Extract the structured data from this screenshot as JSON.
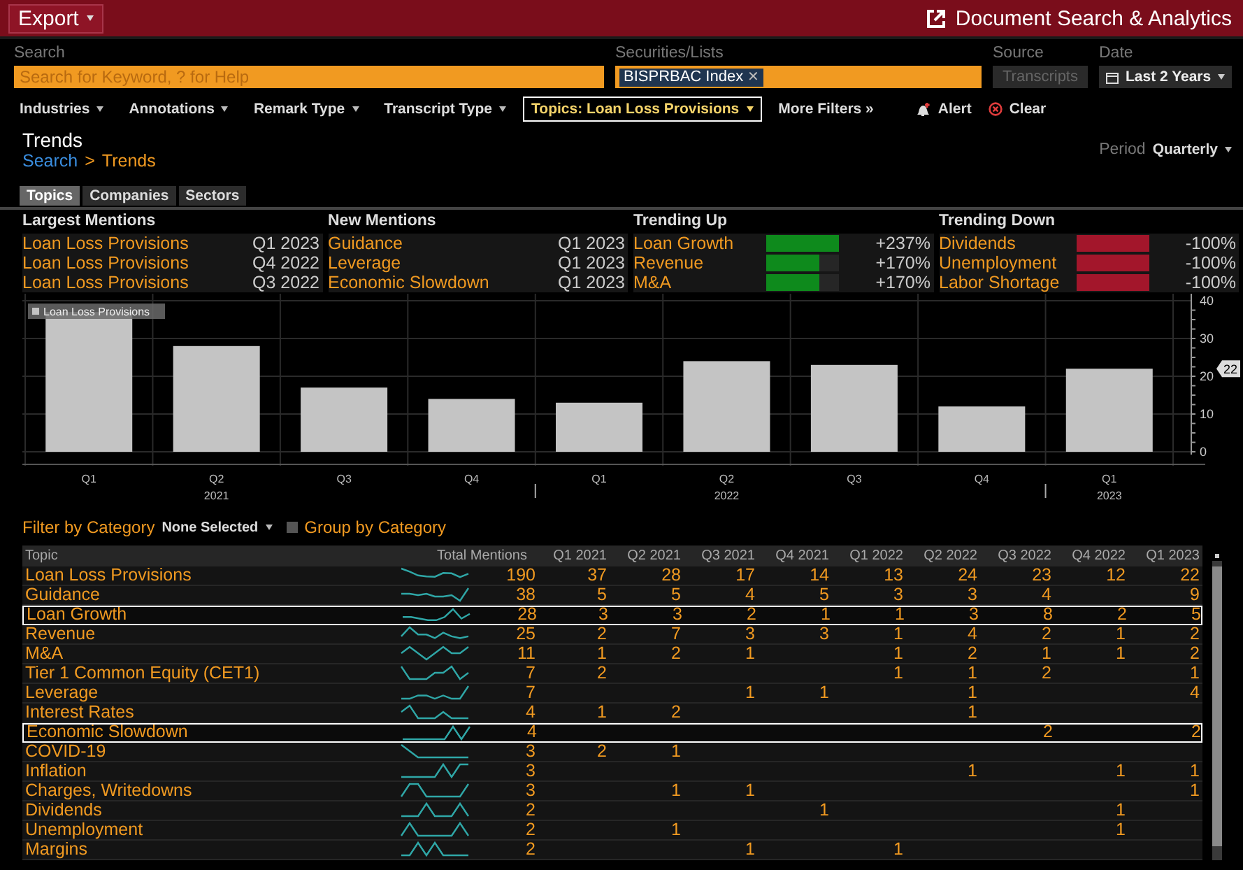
{
  "top_bar": {
    "export_button": "Export",
    "title": "Document Search & Analytics"
  },
  "search_bar": {
    "search": {
      "label": "Search",
      "placeholder": "Search for Keyword, ? for Help"
    },
    "securities": {
      "label": "Securities/Lists",
      "chips": [
        {
          "label": "BISPRBAC Index",
          "remove": "✕"
        }
      ]
    },
    "source": {
      "label": "Source",
      "value": "Transcripts",
      "disabled": true
    },
    "date": {
      "label": "Date",
      "value": "Last 2 Years"
    }
  },
  "filters": [
    {
      "kind": "dropdown",
      "label": "Industries",
      "selected": false
    },
    {
      "kind": "dropdown",
      "label": "Annotations",
      "selected": false
    },
    {
      "kind": "dropdown",
      "label": "Remark Type",
      "selected": false
    },
    {
      "kind": "dropdown",
      "label": "Transcript Type",
      "selected": false
    },
    {
      "kind": "dropdown",
      "label": "Topics: Loan Loss Provisions",
      "selected": true
    },
    {
      "kind": "more",
      "label": "More Filters »",
      "selected": false
    },
    {
      "kind": "alert",
      "label": "Alert",
      "selected": false
    },
    {
      "kind": "clear",
      "label": "Clear",
      "selected": false
    }
  ],
  "page": {
    "title": "Trends",
    "breadcrumb": [
      "Search",
      "Trends"
    ],
    "separator": ">",
    "period_label": "Period",
    "period_value": "Quarterly"
  },
  "tabs": [
    {
      "label": "Topics",
      "selected": true
    },
    {
      "label": "Companies",
      "selected": false
    },
    {
      "label": "Sectors",
      "selected": false
    }
  ],
  "mentions": [
    {
      "kind": "period",
      "title": "Largest Mentions",
      "items": [
        {
          "topic": "Loan Loss Provisions",
          "value": "Q1 2023"
        },
        {
          "topic": "Loan Loss Provisions",
          "value": "Q4 2022"
        },
        {
          "topic": "Loan Loss Provisions",
          "value": "Q3 2022"
        }
      ]
    },
    {
      "kind": "period",
      "title": "New Mentions",
      "items": [
        {
          "topic": "Guidance",
          "value": "Q1 2023"
        },
        {
          "topic": "Leverage",
          "value": "Q1 2023"
        },
        {
          "topic": "Economic Slowdown",
          "value": "Q1 2023"
        }
      ]
    },
    {
      "kind": "trend",
      "title": "Trending Up",
      "color": "#0e8a1c",
      "items": [
        {
          "topic": "Loan Growth",
          "value": "+237%",
          "level": 1
        },
        {
          "topic": "Revenue",
          "value": "+170%",
          "level": 0.72
        },
        {
          "topic": "M&A",
          "value": "+170%",
          "level": 0.72
        }
      ]
    },
    {
      "kind": "trend",
      "title": "Trending Down",
      "color": "#a3162b",
      "items": [
        {
          "topic": "Dividends",
          "value": "-100%",
          "level": 1
        },
        {
          "topic": "Unemployment",
          "value": "-100%",
          "level": 1
        },
        {
          "topic": "Labor Shortage",
          "value": "-100%",
          "level": 1
        }
      ]
    }
  ],
  "chart": {
    "year_labels": [
      "2021",
      "2022",
      "2023"
    ],
    "value_marker": "22",
    "chart_data": {
      "type": "bar",
      "categories": [
        "Q1",
        "Q2",
        "Q3",
        "Q4",
        "Q1",
        "Q2",
        "Q3",
        "Q4",
        "Q1"
      ],
      "series": [
        {
          "name": "Loan Loss Provisions",
          "color": "#c4c4c4",
          "values": [
            37,
            28,
            17,
            14,
            13,
            24,
            23,
            12,
            22
          ]
        }
      ],
      "ylim": [
        0,
        40
      ],
      "yticks": [
        0,
        10,
        20,
        30,
        40
      ],
      "grid": true
    }
  },
  "category_bar": {
    "filter_label": "Filter by Category",
    "filter_value": "None Selected",
    "group_label": "Group by Category",
    "group_checked": false
  },
  "table": {
    "columns": [
      "Topic",
      "Total Mentions",
      "Q1 2021",
      "Q2 2021",
      "Q3 2021",
      "Q4 2021",
      "Q1 2022",
      "Q2 2022",
      "Q3 2022",
      "Q4 2022",
      "Q1 2023"
    ],
    "rows": [
      {
        "topic": "Loan Loss Provisions",
        "total": "190",
        "highlighted": false,
        "counts": {
          "q1_2021": "37",
          "q2_2021": "28",
          "q3_2021": "17",
          "q4_2021": "14",
          "q1_2022": "13",
          "q2_2022": "24",
          "q3_2022": "23",
          "q4_2022": "12",
          "q1_2023": "22"
        }
      },
      {
        "topic": "Guidance",
        "total": "38",
        "highlighted": false,
        "counts": {
          "q1_2021": "5",
          "q2_2021": "5",
          "q3_2021": "4",
          "q4_2021": "5",
          "q1_2022": "3",
          "q2_2022": "3",
          "q3_2022": "4",
          "q1_2023": "9"
        }
      },
      {
        "topic": "Loan Growth",
        "total": "28",
        "highlighted": true,
        "counts": {
          "q1_2021": "3",
          "q2_2021": "3",
          "q3_2021": "2",
          "q4_2021": "1",
          "q1_2022": "1",
          "q2_2022": "3",
          "q3_2022": "8",
          "q4_2022": "2",
          "q1_2023": "5"
        }
      },
      {
        "topic": "Revenue",
        "total": "25",
        "highlighted": false,
        "counts": {
          "q1_2021": "2",
          "q2_2021": "7",
          "q3_2021": "3",
          "q4_2021": "3",
          "q1_2022": "1",
          "q2_2022": "4",
          "q3_2022": "2",
          "q4_2022": "1",
          "q1_2023": "2"
        }
      },
      {
        "topic": "M&A",
        "total": "11",
        "highlighted": false,
        "counts": {
          "q1_2021": "1",
          "q2_2021": "2",
          "q3_2021": "1",
          "q1_2022": "1",
          "q2_2022": "2",
          "q3_2022": "1",
          "q4_2022": "1",
          "q1_2023": "2"
        }
      },
      {
        "topic": "Tier 1 Common Equity (CET1)",
        "total": "7",
        "highlighted": false,
        "counts": {
          "q1_2021": "2",
          "q1_2022": "1",
          "q2_2022": "1",
          "q3_2022": "2",
          "q1_2023": "1"
        }
      },
      {
        "topic": "Leverage",
        "total": "7",
        "highlighted": false,
        "counts": {
          "q3_2021": "1",
          "q4_2021": "1",
          "q2_2022": "1",
          "q1_2023": "4"
        }
      },
      {
        "topic": "Interest Rates",
        "total": "4",
        "highlighted": false,
        "counts": {
          "q1_2021": "1",
          "q2_2021": "2",
          "q2_2022": "1"
        }
      },
      {
        "topic": "Economic Slowdown",
        "total": "4",
        "highlighted": true,
        "counts": {
          "q3_2022": "2",
          "q1_2023": "2"
        }
      },
      {
        "topic": "COVID-19",
        "total": "3",
        "highlighted": false,
        "counts": {
          "q1_2021": "2",
          "q2_2021": "1"
        }
      },
      {
        "topic": "Inflation",
        "total": "3",
        "highlighted": false,
        "counts": {
          "q2_2022": "1",
          "q4_2022": "1",
          "q1_2023": "1"
        }
      },
      {
        "topic": "Charges, Writedowns",
        "total": "3",
        "highlighted": false,
        "counts": {
          "q2_2021": "1",
          "q3_2021": "1",
          "q1_2023": "1"
        }
      },
      {
        "topic": "Dividends",
        "total": "2",
        "highlighted": false,
        "counts": {
          "q4_2021": "1",
          "q4_2022": "1"
        }
      },
      {
        "topic": "Unemployment",
        "total": "2",
        "highlighted": false,
        "counts": {
          "q2_2021": "1",
          "q4_2022": "1"
        }
      },
      {
        "topic": "Margins",
        "total": "2",
        "highlighted": false,
        "counts": {
          "q3_2021": "1",
          "q1_2022": "1"
        }
      }
    ]
  }
}
